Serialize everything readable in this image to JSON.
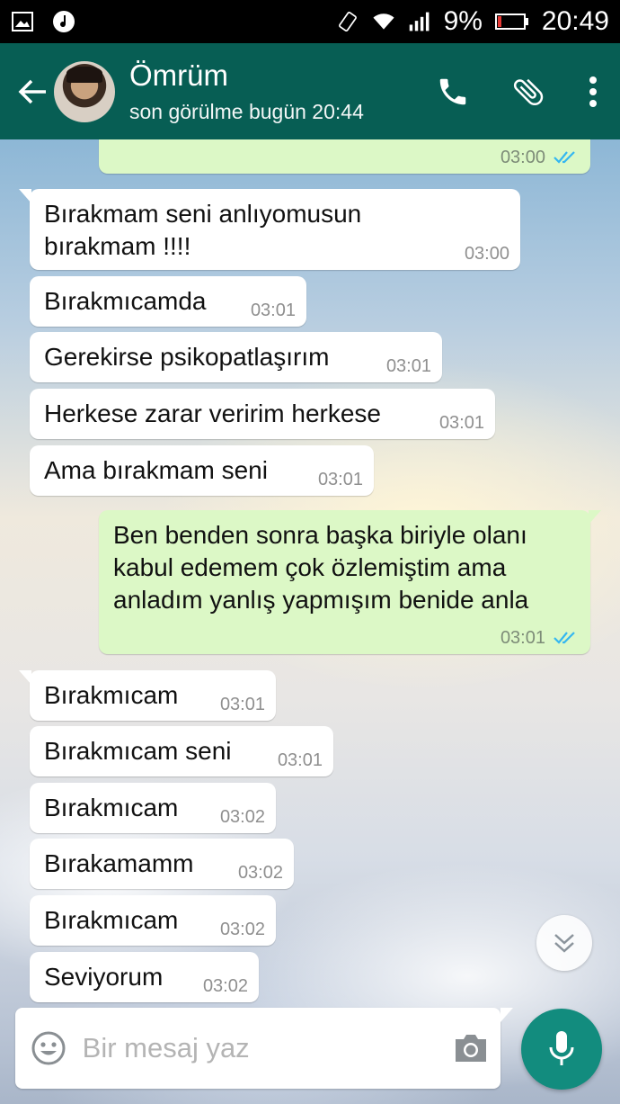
{
  "status_bar": {
    "battery_percent": "9%",
    "time": "20:49"
  },
  "header": {
    "contact_name": "Ömrüm",
    "last_seen": "son görülme bugün 20:44"
  },
  "messages": [
    {
      "dir": "out",
      "text": "",
      "time": "03:00",
      "ticks": true
    },
    {
      "dir": "in",
      "text": "Bırakmam seni anlıyomusun bırakmam !!!!",
      "time": "03:00"
    },
    {
      "dir": "in",
      "text": "Bırakmıcamda",
      "time": "03:01"
    },
    {
      "dir": "in",
      "text": "Gerekirse psikopatlaşırım",
      "time": "03:01"
    },
    {
      "dir": "in",
      "text": "Herkese zarar veririm herkese",
      "time": "03:01"
    },
    {
      "dir": "in",
      "text": "Ama bırakmam seni",
      "time": "03:01"
    },
    {
      "dir": "out",
      "text": "Ben benden sonra başka biriyle olanı kabul edemem çok özlemiştim ama anladım yanlış yapmışım benide anla",
      "time": "03:01",
      "ticks": true
    },
    {
      "dir": "in",
      "text": "Bırakmıcam",
      "time": "03:01"
    },
    {
      "dir": "in",
      "text": "Bırakmıcam seni",
      "time": "03:01"
    },
    {
      "dir": "in",
      "text": "Bırakmıcam",
      "time": "03:02"
    },
    {
      "dir": "in",
      "text": "Bırakamamm",
      "time": "03:02"
    },
    {
      "dir": "in",
      "text": "Bırakmıcam",
      "time": "03:02"
    },
    {
      "dir": "in",
      "text": "Seviyorum",
      "time": "03:02"
    }
  ],
  "composer": {
    "placeholder": "Bir mesaj yaz"
  },
  "colors": {
    "app_bar": "#075e54",
    "outgoing_bubble": "#dcf8c6",
    "incoming_bubble": "#ffffff",
    "read_ticks": "#34b7f1",
    "mic_button": "#128c7e"
  }
}
